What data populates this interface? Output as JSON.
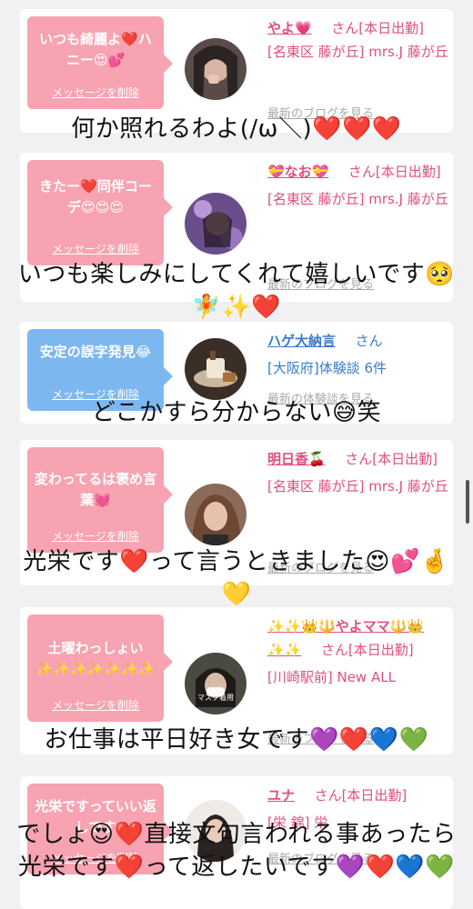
{
  "cards": [
    {
      "bubble": "いつも綺麗よ❤️ハニー😍💕",
      "delete": "メッセージを削除",
      "name": "やよ💗",
      "san": "さん[本日出勤]",
      "loc": "[名東区 藤が丘] mrs.J 藤が丘",
      "more": "最新のブログを見る"
    },
    {
      "bubble": "きたー❤️同伴コーデ😍😍😍",
      "delete": "メッセージを削除",
      "name": "💝なお💝",
      "san": "さん[本日出勤]",
      "loc": "[名東区 藤が丘] mrs.J 藤が丘",
      "more": "最新のブログを見る"
    },
    {
      "bubble": "安定の誤字発見😂",
      "delete": "メッセージを削除",
      "name": "ハゲ大納言",
      "san": "さん",
      "loc": "[大阪府]体験談 6件",
      "more": "最新の体験談を見る"
    },
    {
      "bubble": "変わってるは褒め言葉💓",
      "delete": "メッセージを削除",
      "name": "明日香🍒",
      "san": "さん[本日出勤]",
      "loc": "[名東区 藤が丘] mrs.J 藤が丘",
      "more": "最新のブログを見る"
    },
    {
      "bubble": "土曜わっしょい✨✨✨✨✨✨✨",
      "delete": "メッセージを削除",
      "name": "✨✨👑🔱やよママ🔱👑✨✨",
      "san": "さん[本日出勤]",
      "loc": "[川崎駅前] New ALL",
      "more": "最新のブログを見る"
    },
    {
      "bubble": "光栄ですっていい返しです",
      "delete": "メッセージを削除",
      "name": "ユナ",
      "san": "さん[本日出勤]",
      "loc": "[栄 錦] 栄",
      "more": "最新のブログを見る"
    }
  ],
  "overlays": [
    "何か照れるわよ(/ω＼)❤️❤️❤️",
    "いつも楽しみにしてくれて嬉しいです🥺🧚✨❤️",
    "どこかすら分からない😅笑",
    "光栄です❤️って言うときました😍💕🤞💛",
    "お仕事は平日好き女です💜❤️💙💚",
    "でしょ😍❤️直接文句言われる事あったら光栄です❤️って返したいです💜❤️💙💚"
  ],
  "avatar_labels": {
    "avatar5": "マスク着用"
  },
  "colors": {
    "pink_bubble": "#f7a3b1",
    "blue_bubble": "#7db7ef",
    "name_pink": "#e0507a",
    "name_blue": "#3a7bc8"
  }
}
